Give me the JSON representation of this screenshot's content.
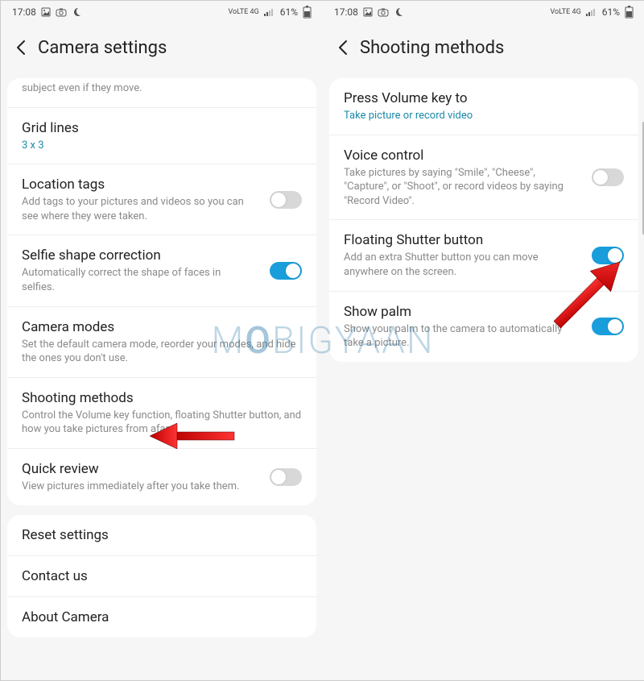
{
  "status": {
    "time": "17:08",
    "net_label": "VoLTE 4G",
    "battery": "61%"
  },
  "left": {
    "title": "Camera settings",
    "truncated_sub": "subject even if they move.",
    "rows": {
      "grid": {
        "title": "Grid lines",
        "sub": "3 x 3"
      },
      "location": {
        "title": "Location tags",
        "sub": "Add tags to your pictures and videos so you can see where they were taken."
      },
      "selfie": {
        "title": "Selfie shape correction",
        "sub": "Automatically correct the shape of faces in selfies."
      },
      "modes": {
        "title": "Camera modes",
        "sub": "Set the default camera mode, reorder your modes, and hide the ones you don't use."
      },
      "shooting": {
        "title": "Shooting methods",
        "sub": "Control the Volume key function, floating Shutter button, and how you take pictures from afar."
      },
      "quick": {
        "title": "Quick review",
        "sub": "View pictures immediately after you take them."
      }
    },
    "footer": {
      "reset": "Reset settings",
      "contact": "Contact us",
      "about": "About Camera"
    }
  },
  "right": {
    "title": "Shooting methods",
    "rows": {
      "volume": {
        "title": "Press Volume key to",
        "sub": "Take picture or record video"
      },
      "voice": {
        "title": "Voice control",
        "sub": "Take pictures by saying \"Smile\", \"Cheese\", \"Capture\", or \"Shoot\", or record videos by saying \"Record Video\"."
      },
      "floating": {
        "title": "Floating Shutter button",
        "sub": "Add an extra Shutter button you can move anywhere on the screen."
      },
      "palm": {
        "title": "Show palm",
        "sub": "Show your palm to the camera to automatically take a picture."
      }
    }
  },
  "watermark": {
    "pre": "M",
    "mid": "O",
    "post": "BIGYAAN"
  }
}
